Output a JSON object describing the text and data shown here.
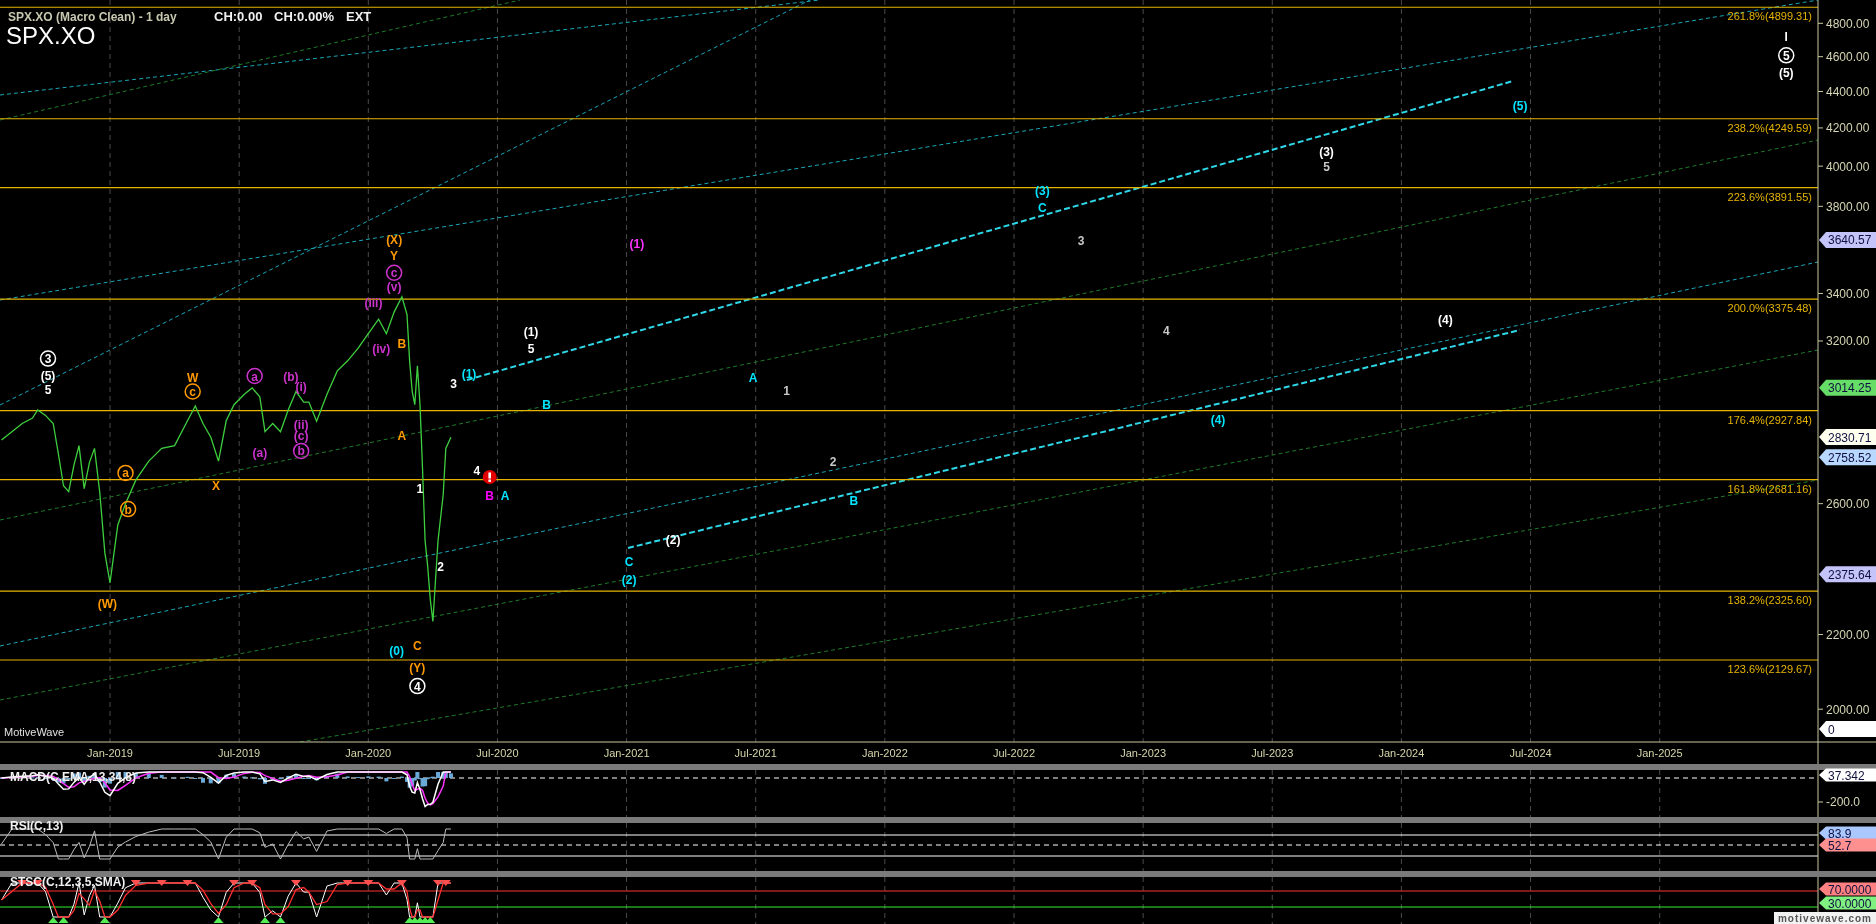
{
  "header": {
    "title": "SPX.XO (Macro Clean) - 1 day",
    "change": "CH:0.00",
    "change_percent": "CH:0.00%",
    "session": "EXT",
    "symbol": "SPX.XO"
  },
  "chart": {
    "fib_levels": [
      "261.8%(4899.31)",
      "238.2%(4249.59)",
      "223.6%(3891.55)",
      "200.0%(3375.48)",
      "176.4%(2927.84)",
      "161.8%(2681.16)",
      "138.2%(2325.60)",
      "123.6%(2129.67)"
    ],
    "price_axis": [
      "4800.00",
      "4600.00",
      "4400.00",
      "4200.00",
      "4000.00",
      "3800.00",
      "3400.00",
      "3200.00",
      "2600.00",
      "2200.00",
      "2000.00"
    ],
    "price_tags": [
      {
        "text": "3640.57",
        "color": "#c4c4fa"
      },
      {
        "text": "3014.25",
        "color": "#66dd66"
      },
      {
        "text": "2830.71",
        "color": "#fffff0"
      },
      {
        "text": "2758.52",
        "color": "#b8d8ff"
      },
      {
        "text": "2375.64",
        "color": "#c4c4fa"
      },
      {
        "text": "0",
        "color": "#ffffff"
      }
    ],
    "date_axis": [
      "Jan-2019",
      "Jul-2019",
      "Jan-2020",
      "Jul-2020",
      "Jan-2021",
      "Jul-2021",
      "Jan-2022",
      "Jul-2022",
      "Jan-2023",
      "Jul-2023",
      "Jan-2024",
      "Jul-2024",
      "Jan-2025"
    ],
    "wave_labels": [
      {
        "text": "3",
        "color": "#ffffff",
        "circled": true
      },
      {
        "text": "(5)",
        "color": "#ffffff",
        "circled": false
      },
      {
        "text": "5",
        "color": "#ffffff",
        "circled": false
      },
      {
        "text": "W",
        "color": "#ff9900",
        "circled": false
      },
      {
        "text": "c",
        "color": "#ff9900",
        "circled": true
      },
      {
        "text": "a",
        "color": "#ff9900",
        "circled": true
      },
      {
        "text": "b",
        "color": "#ff9900",
        "circled": true
      },
      {
        "text": "X",
        "color": "#ff9900",
        "circled": false
      },
      {
        "text": "(W)",
        "color": "#ff9900",
        "circled": false
      },
      {
        "text": "a",
        "color": "#cc33cc",
        "circled": true
      },
      {
        "text": "(a)",
        "color": "#cc33cc",
        "circled": false
      },
      {
        "text": "(b)",
        "color": "#cc33cc",
        "circled": false
      },
      {
        "text": "(i)",
        "color": "#cc33cc",
        "circled": false
      },
      {
        "text": "(ii)",
        "color": "#cc33cc",
        "circled": false
      },
      {
        "text": "(c)",
        "color": "#cc33cc",
        "circled": false
      },
      {
        "text": "b",
        "color": "#cc33cc",
        "circled": true
      },
      {
        "text": "(X)",
        "color": "#ff9900",
        "circled": false
      },
      {
        "text": "Y",
        "color": "#ff9900",
        "circled": false
      },
      {
        "text": "c",
        "color": "#cc33cc",
        "circled": true
      },
      {
        "text": "(v)",
        "color": "#cc33cc",
        "circled": false
      },
      {
        "text": "(iii)",
        "color": "#cc33cc",
        "circled": false
      },
      {
        "text": "(iv)",
        "color": "#cc33cc",
        "circled": false
      },
      {
        "text": "B",
        "color": "#ff9900",
        "circled": false
      },
      {
        "text": "A",
        "color": "#ff9900",
        "circled": false
      },
      {
        "text": "1",
        "color": "#ffffff",
        "circled": false
      },
      {
        "text": "2",
        "color": "#ffffff",
        "circled": false
      },
      {
        "text": "(0)",
        "color": "#00e5ff",
        "circled": false
      },
      {
        "text": "C",
        "color": "#ff9900",
        "circled": false
      },
      {
        "text": "(Y)",
        "color": "#ff9900",
        "circled": false
      },
      {
        "text": "4",
        "color": "#ffffff",
        "circled": true
      },
      {
        "text": "3",
        "color": "#ffffff",
        "circled": false
      },
      {
        "text": "(1)",
        "color": "#00e5ff",
        "circled": false
      },
      {
        "text": "4",
        "color": "#ffffff",
        "circled": false
      },
      {
        "text": "B",
        "color": "#ff00ff",
        "circled": false
      },
      {
        "text": "A",
        "color": "#00e5ff",
        "circled": false
      },
      {
        "text": "B",
        "color": "#00e5ff",
        "circled": false
      },
      {
        "text": "(1)",
        "color": "#ffffff",
        "circled": false
      },
      {
        "text": "5",
        "color": "#ffffff",
        "circled": false
      },
      {
        "text": "(1)",
        "color": "#ff33ff",
        "circled": false
      },
      {
        "text": "A",
        "color": "#00e5ff",
        "circled": false
      },
      {
        "text": "1",
        "color": "#c8c8c8",
        "circled": false
      },
      {
        "text": "2",
        "color": "#c8c8c8",
        "circled": false
      },
      {
        "text": "B",
        "color": "#00e5ff",
        "circled": false
      },
      {
        "text": "C",
        "color": "#00e5ff",
        "circled": false
      },
      {
        "text": "(2)",
        "color": "#00e5ff",
        "circled": false
      },
      {
        "text": "(2)",
        "color": "#ffffff",
        "circled": false
      },
      {
        "text": "(3)",
        "color": "#00e5ff",
        "circled": false
      },
      {
        "text": "C",
        "color": "#00e5ff",
        "circled": false
      },
      {
        "text": "3",
        "color": "#c8c8c8",
        "circled": false
      },
      {
        "text": "4",
        "color": "#c8c8c8",
        "circled": false
      },
      {
        "text": "(3)",
        "color": "#ffffff",
        "circled": false
      },
      {
        "text": "5",
        "color": "#c8c8c8",
        "circled": false
      },
      {
        "text": "(4)",
        "color": "#ffffff",
        "circled": false
      },
      {
        "text": "(4)",
        "color": "#00e5ff",
        "circled": false
      },
      {
        "text": "(5)",
        "color": "#00e5ff",
        "circled": false
      },
      {
        "text": "I",
        "color": "#ffffff",
        "circled": false
      },
      {
        "text": "5",
        "color": "#ffffff",
        "circled": true
      },
      {
        "text": "(5)",
        "color": "#ffffff",
        "circled": false
      }
    ],
    "brand": "MotiveWave"
  },
  "indicators": [
    {
      "kind": "macd",
      "label": "MACD(C,EMA,13,34,8)",
      "tags": [
        {
          "text": "37.342",
          "color": "#ffffff"
        }
      ],
      "axis_labels": [
        "-200.0"
      ]
    },
    {
      "kind": "rsi",
      "label": "RSI(C,13)",
      "tags": [
        {
          "text": "83.9",
          "color": "#a8c8ff"
        },
        {
          "text": "52.7",
          "color": "#ff9090"
        }
      ]
    },
    {
      "kind": "stsc",
      "label": "STSC(C,12,3,5,SMA)",
      "tags": [
        {
          "text": "70.0000",
          "color": "#ff8080"
        },
        {
          "text": "30.0000",
          "color": "#80f080"
        }
      ]
    }
  ],
  "footer": {
    "site": "motivewave.com"
  }
}
